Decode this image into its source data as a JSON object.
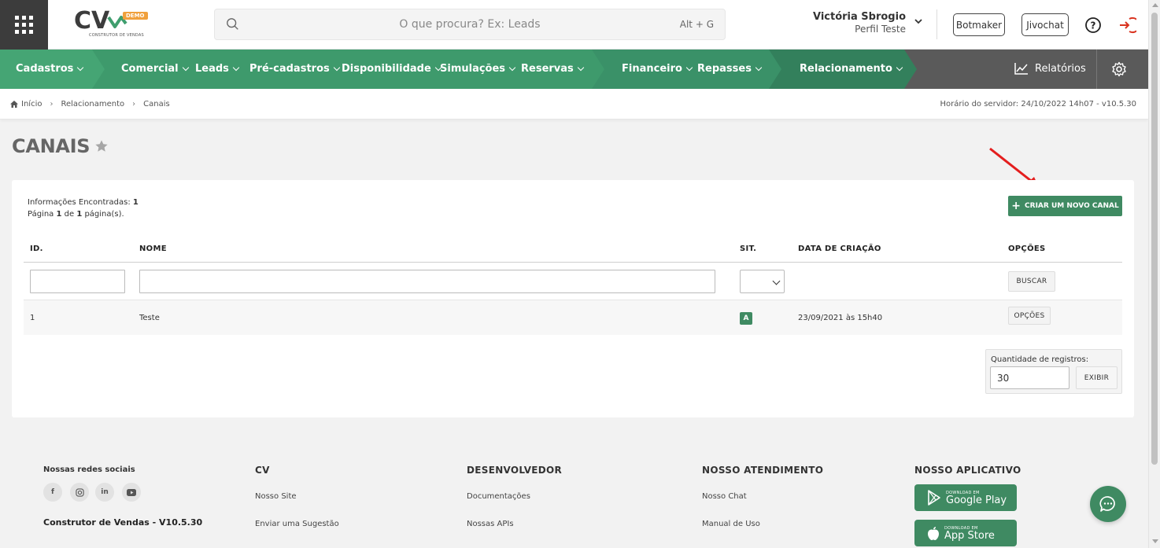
{
  "header": {
    "logo_text": "CV",
    "logo_tag": "DEMO",
    "logo_sub": "CONSTRUTOR DE VENDAS",
    "search_placeholder": "O que procura? Ex: Leads",
    "search_shortcut": "Alt + G",
    "user_name": "Victória Sbrogio",
    "user_role": "Perfil Teste",
    "botmaker_label": "Botmaker",
    "jivochat_label": "Jivochat"
  },
  "nav": {
    "items": [
      {
        "label": "Cadastros"
      },
      {
        "label": "Comercial"
      },
      {
        "label": "Leads"
      },
      {
        "label": "Pré-cadastros"
      },
      {
        "label": "Disponibilidade"
      },
      {
        "label": "Simulações"
      },
      {
        "label": "Reservas"
      },
      {
        "label": "Financeiro"
      },
      {
        "label": "Repasses"
      },
      {
        "label": "Relacionamento"
      }
    ],
    "reports_label": "Relatórios",
    "colors": {
      "seg1": "#3f9e6e",
      "seg2": "#3a9168",
      "seg3": "#33805c",
      "seg4": "#2f6f51",
      "rest": "#5a5a5a"
    }
  },
  "breadcrumb": {
    "items": [
      "Início",
      "Relacionamento",
      "Canais"
    ],
    "server_time": "Horário do servidor: 24/10/2022 14h07 - v10.5.30"
  },
  "page": {
    "title": "CANAIS",
    "info_label_found": "Informações Encontradas: ",
    "info_found": "1",
    "info_page_prefix": "Página ",
    "info_page": "1",
    "info_page_mid": " de ",
    "info_pages": "1",
    "info_page_suffix": " página(s).",
    "create_button": "CRIAR UM NOVO CANAL"
  },
  "table": {
    "columns": [
      "ID.",
      "NOME",
      "SIT.",
      "DATA DE CRIAÇÃO",
      "OPÇÕES"
    ],
    "search_button": "BUSCAR",
    "rows": [
      {
        "id": "1",
        "name": "Teste",
        "status": "A",
        "created": "23/09/2021 às 15h40",
        "options": "OPÇÕES"
      }
    ]
  },
  "pagination": {
    "label": "Quantidade de registros:",
    "value": "30",
    "button": "EXIBIR"
  },
  "footer": {
    "social_title": "Nossas redes sociais",
    "social": [
      "f",
      "ig",
      "in",
      "yt"
    ],
    "version": "Construtor de Vendas - V10.5.30",
    "cv_title": "CV",
    "cv_links": [
      "Nosso Site",
      "Enviar uma Sugestão"
    ],
    "dev_title": "DESENVOLVEDOR",
    "dev_links": [
      "Documentações",
      "Nossas APIs"
    ],
    "support_title": "NOSSO ATENDIMENTO",
    "support_links": [
      "Nosso Chat",
      "Manual de Uso"
    ],
    "app_title": "NOSSO APLICATIVO",
    "google_small": "DOWNLOAD EM",
    "google_big": "Google Play",
    "apple_small": "DOWNLOAD EM",
    "apple_big": "App Store"
  }
}
